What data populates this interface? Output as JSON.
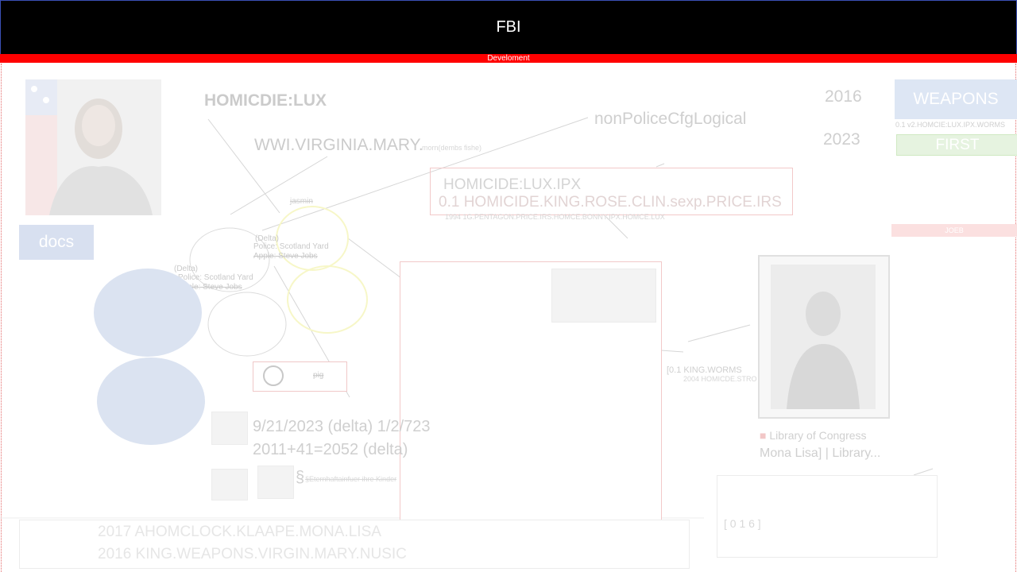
{
  "header": {
    "title": "FBI",
    "subtitle": "Develoment"
  },
  "labels": {
    "homicide_lux": "HOMICDIE:LUX",
    "virginia": "WWI.VIRGINIA.MARY.",
    "virginia_small": "morn(dembs fishe)",
    "non_police": "nonPoliceCfgLogical",
    "year_2016": "2016",
    "year_2023": "2023",
    "jasmin": "jasmin",
    "delta_a": "(Delta)",
    "police_a": "Police: Scotland Yard",
    "apple_a": "Apple: Steve Jobs",
    "delta_b": "(Delta)",
    "police_b": "Police: Scotland Yard",
    "apple_b": "Apple: Steve Jobs",
    "docs": "docs",
    "weapons": "WEAPONS",
    "weapons_sub": "0.1 v2.HOMCIE:LUX.IPX.WORMS",
    "first": "FIRST",
    "joeb": "JOEB",
    "hbox_line1": "HOMICIDE:LUX.IPX",
    "hbox_line2": "0.1 HOMICIDE.KING.ROSE.CLIN.sexp.PRICE.IRS",
    "hbox_line3": "1994 1G.PENTAGON.PRICE.IRS.HOMCE.BONNY.IPX.HOMCE.LUX",
    "card_text": "pig",
    "date_line1": "9/21/2023 (delta) 1/2/723",
    "date_line2": "2011+41=2052 (delta)",
    "section_line": "§Eternhaftainfuer ihre Kinder",
    "king_worms": "[0.1 KING.WORMS",
    "homicide_stro": "2004 HOMICDE.STRO",
    "library_of_congress": "Library of Congress",
    "mona_lisa": "Mona Lisa] | Library...",
    "rbox_text": "[ 0 1 6 ]",
    "bottom_line1": "2017 AHOMCLOCK.KLAAPE.MONA.LISA",
    "bottom_line2": "2016 KING.WEAPONS.VIRGIN.MARY.NUSIC"
  }
}
